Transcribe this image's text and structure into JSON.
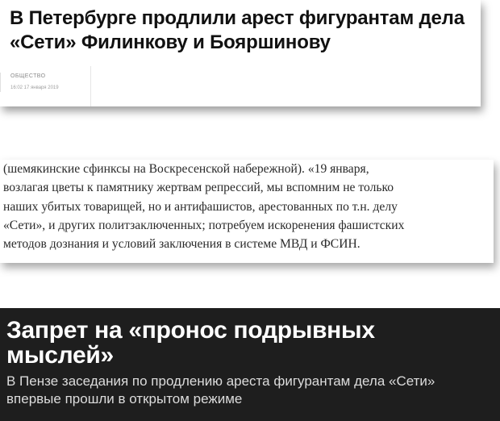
{
  "clip1": {
    "headline_lines": [
      "В Петербурге продлили арест фигурантам дела",
      "«Сети» Филинкову и Бояршинову"
    ],
    "rubric": "ОБЩЕСТВО",
    "date": "16:02 17 января 2019"
  },
  "clip2": {
    "lines": [
      "(шемякинские сфинксы на Воскресенской набережной). «19 января,",
      "возлагая цветы к памятнику жертвам репрессий, мы вспомним не только",
      "наших убитых товарищей, но и антифашистов, арестованных по т.н. делу",
      "«Сети», и других политзаключенных; потребуем искоренения фашистских",
      "методов дознания и условий заключения в системе МВД и ФСИН."
    ]
  },
  "clip3": {
    "title_lines": [
      "Запрет на «пронос подрывных",
      "мыслей»"
    ],
    "subtitle_lines": [
      "В Пензе заседания по продлению ареста фигурантам дела «Сети»",
      "впервые прошли в открытом режиме"
    ]
  }
}
